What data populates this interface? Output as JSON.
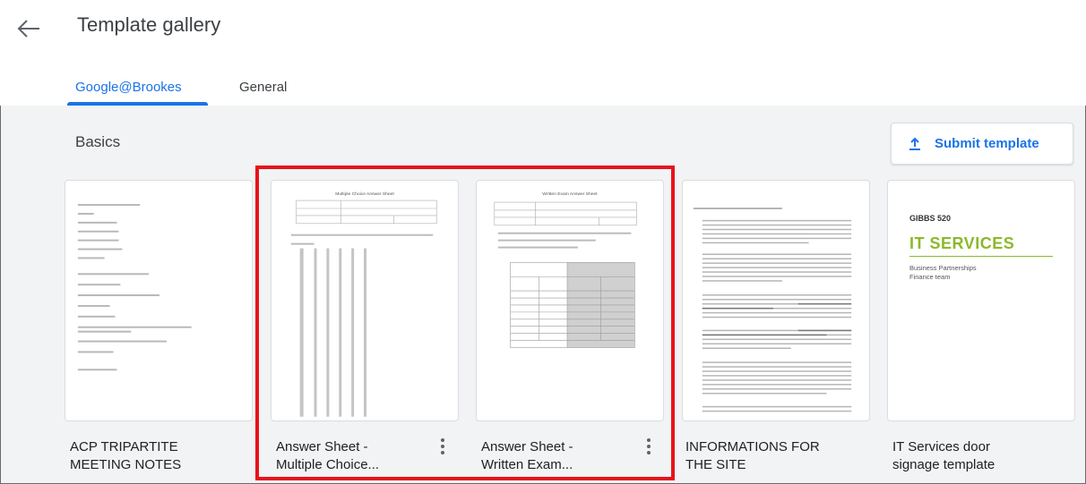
{
  "header": {
    "title": "Template gallery",
    "tabs": [
      {
        "label": "Google@Brookes",
        "active": true
      },
      {
        "label": "General",
        "active": false
      }
    ]
  },
  "section": {
    "title": "Basics",
    "submit_label": "Submit template"
  },
  "templates": [
    {
      "name_line1": "ACP TRIPARTITE",
      "name_line2": "MEETING NOTES"
    },
    {
      "name_line1": "Answer Sheet -",
      "name_line2": "Multiple Choice..."
    },
    {
      "name_line1": "Answer Sheet -",
      "name_line2": "Written Exam..."
    },
    {
      "name_line1": "INFORMATIONS FOR",
      "name_line2": "THE SITE"
    },
    {
      "name_line1": "IT Services door",
      "name_line2": "signage template"
    }
  ],
  "thumbs": {
    "mc_title": "Multiple Choice Answer Sheet",
    "we_title": "Written Exam Answer Sheet",
    "gibbs": "GIBBS 520",
    "it_services": "IT SERVICES",
    "bp_line1": "Business Partnerships",
    "bp_line2": "Finance team"
  },
  "colors": {
    "accent": "#1a73e8",
    "highlight": "#e8121b",
    "it_green": "#8cb82b"
  }
}
